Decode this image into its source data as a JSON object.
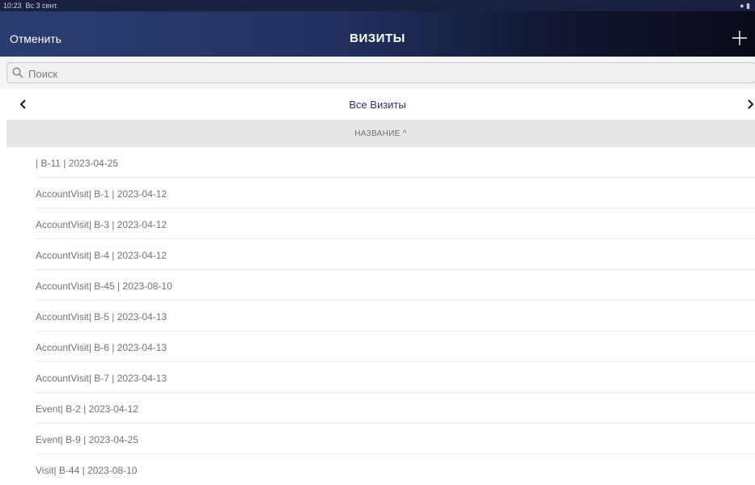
{
  "status_bar": {
    "time": "10:23",
    "date": "Вс 3 сент."
  },
  "nav": {
    "cancel_label": "Отменить",
    "title": "ВИЗИТЫ",
    "add_icon": "plus-icon"
  },
  "search": {
    "placeholder": "Поиск",
    "value": "",
    "icon": "search-icon"
  },
  "filter": {
    "label": "Все Визиты",
    "prev_icon": "chevron-left-icon",
    "next_icon": "chevron-right-icon"
  },
  "column_header": {
    "label": "НАЗВАНИЕ ^",
    "sort": "ascending"
  },
  "visits": [
    "| В-11 | 2023-04-25",
    "AccountVisit| В-1 | 2023-04-12",
    "AccountVisit| В-3 | 2023-04-12",
    "AccountVisit| В-4 | 2023-04-12",
    "AccountVisit| В-45 | 2023-08-10",
    "AccountVisit| В-5 | 2023-04-13",
    "AccountVisit| В-6 | 2023-04-13",
    "AccountVisit| В-7 | 2023-04-13",
    "Event| В-2 | 2023-04-12",
    "Event| В-9 | 2023-04-25",
    "Visit| В-44 | 2023-08-10"
  ],
  "colors": {
    "nav_gradient_start": "#2a3d73",
    "nav_gradient_end": "#080b17",
    "filter_text": "#2a3566",
    "row_text": "#737373",
    "header_bg": "#e6e6e9"
  }
}
